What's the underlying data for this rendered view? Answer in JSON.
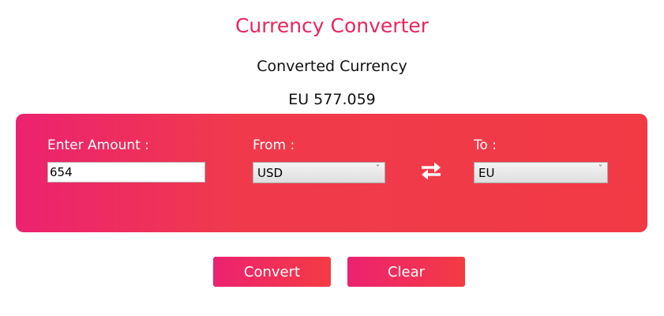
{
  "header": {
    "title": "Currency Converter",
    "result_label": "Converted Currency",
    "result_value": "EU 577.059"
  },
  "form": {
    "amount_label": "Enter Amount :",
    "amount_value": "654",
    "from_label": "From :",
    "from_value": "USD",
    "to_label": "To :",
    "to_value": "EU",
    "dropdown_arrow": "˅",
    "swap_icon": "swap-arrows-icon"
  },
  "actions": {
    "convert_label": "Convert",
    "clear_label": "Clear"
  },
  "colors": {
    "accent": "#e8265f",
    "gradient_start": "#ec2270",
    "gradient_end": "#f23a45",
    "text_on_accent": "#ffffff"
  }
}
